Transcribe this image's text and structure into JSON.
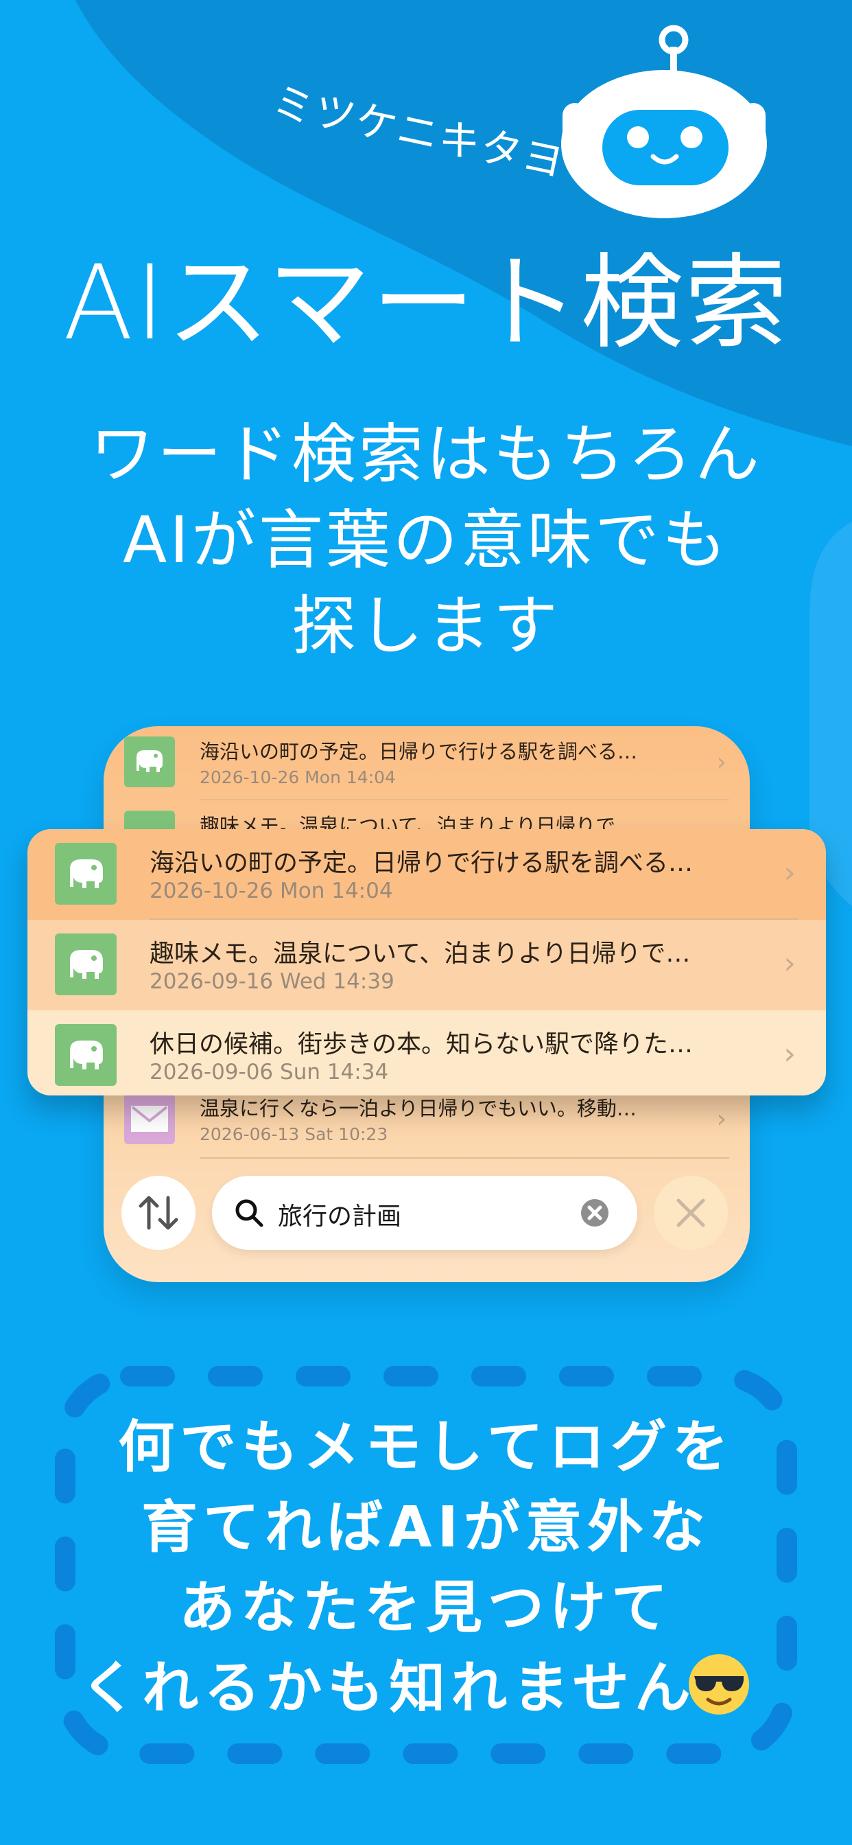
{
  "brand": "ミツケニキタヨ",
  "headline": "AIスマート検索",
  "tagline": [
    "ワード検索はもちろん",
    "AIが言葉の意味でも",
    "探します"
  ],
  "back_list": [
    {
      "title": "海沿いの町の予定。日帰りで行ける駅を調べる…",
      "date": "2026-10-26 Mon 14:04",
      "icon": "elephant-icon"
    },
    {
      "title": "趣味メモ。温泉について、泊まりより日帰りで…",
      "date": "",
      "icon": "elephant-icon"
    },
    {
      "title": "温泉に行くなら一泊より日帰りでもいい。移動…",
      "date": "2026-06-13 Sat 10:23",
      "icon": "mail-icon"
    }
  ],
  "front_list": [
    {
      "title": "海沿いの町の予定。日帰りで行ける駅を調べる…",
      "date": "2026-10-26  Mon 14:04",
      "icon": "elephant-icon"
    },
    {
      "title": "趣味メモ。温泉について、泊まりより日帰りで…",
      "date": "2026-09-16  Wed 14:39",
      "icon": "elephant-icon"
    },
    {
      "title": "休日の候補。街歩きの本。知らない駅で降りた…",
      "date": "2026-09-06  Sun 14:34",
      "icon": "elephant-icon"
    }
  ],
  "search": {
    "query": "旅行の計画"
  },
  "footer": [
    "何でもメモしてログを",
    "育てればAIが意外な",
    "あなたを見つけて",
    "くれるかも知れません"
  ],
  "colors": {
    "background": "#0aa7f2",
    "wave": "#0a8fd6",
    "dash": "#0b84dd",
    "row_highlight": "#fbbf86",
    "row_mid": "#fcd3a8",
    "row_light": "#fde9c9",
    "icon_green": "#7fc37a",
    "icon_pink": "#d9a8d9"
  }
}
